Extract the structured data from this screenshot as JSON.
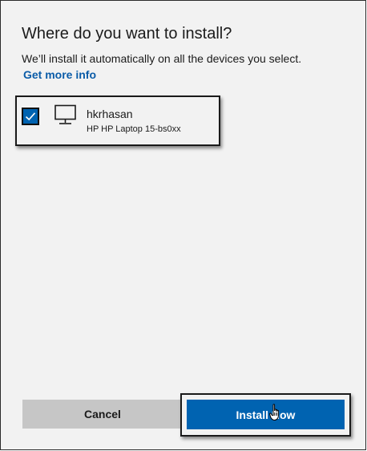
{
  "dialog": {
    "title": "Where do you want to install?",
    "description": "We’ll install it automatically on all the devices you select.",
    "more_info_link": "Get more info"
  },
  "devices": [
    {
      "name": "hkrhasan",
      "model": "HP HP Laptop 15-bs0xx",
      "checked": true,
      "icon": "desktop-pc-icon"
    }
  ],
  "buttons": {
    "cancel_label": "Cancel",
    "install_label": "Install Now"
  },
  "colors": {
    "accent": "#0063b1",
    "link": "#0b5ca8",
    "dialog_bg": "#f2f2f2",
    "secondary_button": "#c6c6c6"
  },
  "icons": {
    "checkbox": "checkmark-icon",
    "device": "desktop-pc-icon",
    "cursor": "hand-pointer-icon"
  }
}
